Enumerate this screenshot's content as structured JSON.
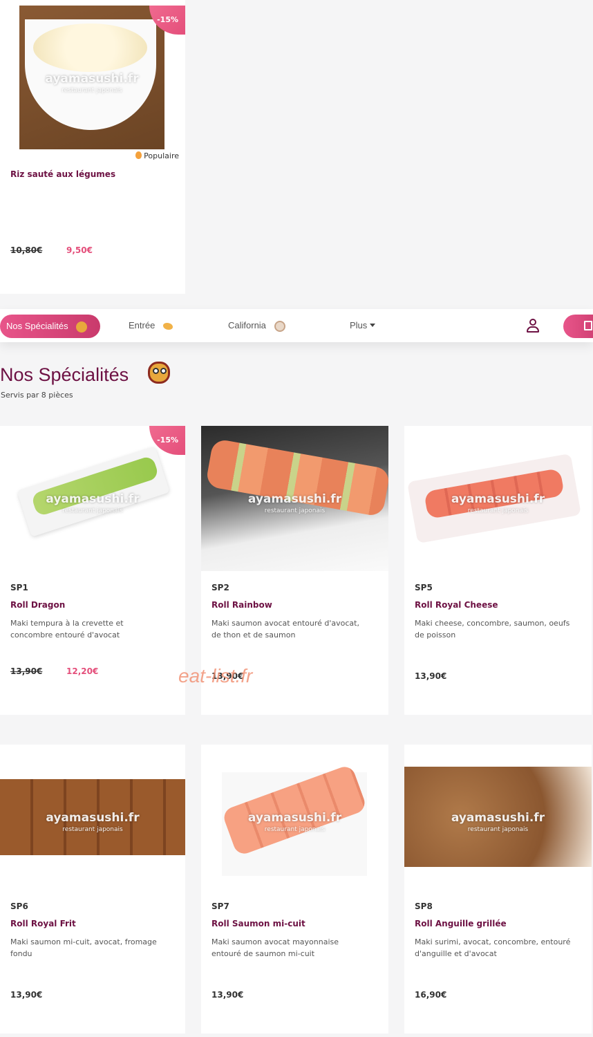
{
  "top_card": {
    "badge": "-15%",
    "popular": "Populaire",
    "name": "Riz sauté aux légumes",
    "price_old": "10,80€",
    "price_new": "9,50€",
    "watermark": "ayamasushi.fr",
    "watermark_sub": "restaurant japonais"
  },
  "nav": {
    "items": [
      {
        "label": "Nos Spécialités"
      },
      {
        "label": "Entrée"
      },
      {
        "label": "California"
      },
      {
        "label": "Plus"
      }
    ]
  },
  "section": {
    "title": "Nos Spécialités",
    "subtitle": "Servis par 8 pièces"
  },
  "products": [
    {
      "code": "SP1",
      "name": "Roll Dragon",
      "desc": "Maki tempura à la crevette et concombre entouré d'avocat",
      "price_old": "13,90€",
      "price_new": "12,20€",
      "badge": "-15%"
    },
    {
      "code": "SP2",
      "name": "Roll Rainbow",
      "desc": "Maki saumon avocat entouré d'avocat, de thon et de saumon",
      "price": "13,90€"
    },
    {
      "code": "SP5",
      "name": "Roll Royal Cheese",
      "desc": "Maki cheese, concombre, saumon, oeufs de poisson",
      "price": "13,90€"
    },
    {
      "code": "SP6",
      "name": "Roll Royal Frit",
      "desc": "Maki saumon mi-cuit, avocat, fromage fondu",
      "price": "13,90€"
    },
    {
      "code": "SP7",
      "name": "Roll Saumon mi-cuit",
      "desc": "Maki saumon avocat mayonnaise entouré de saumon mi-cuit",
      "price": "13,90€"
    },
    {
      "code": "SP8",
      "name": "Roll Anguille grillée",
      "desc": "Maki surimi, avocat, concombre, entouré d'anguille et d'avocat",
      "price": "16,90€"
    }
  ],
  "site_watermark": "eat-list.fr",
  "colors": {
    "accent": "#e44f7b",
    "brand": "#6d1143"
  }
}
